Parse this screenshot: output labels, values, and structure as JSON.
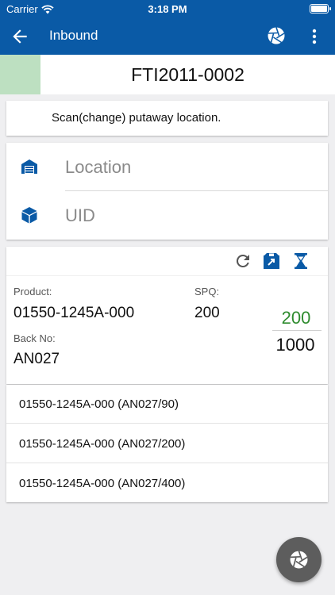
{
  "status_bar": {
    "carrier": "Carrier",
    "time": "3:18 PM"
  },
  "nav": {
    "title": "Inbound",
    "icons": {
      "back": "arrow-left-icon",
      "camera": "aperture-icon",
      "more": "more-vertical-icon"
    }
  },
  "document": {
    "number": "FTI2011-0002",
    "status_color": "#bde0c1"
  },
  "instruction": {
    "text": "Scan(change) putaway location."
  },
  "scan": {
    "location_placeholder": "Location",
    "uid_placeholder": "UID",
    "icons": {
      "location": "warehouse-icon",
      "uid": "box-icon"
    }
  },
  "product": {
    "toolbar_icons": [
      "refresh-icon",
      "box-arrow-icon",
      "hourglass-icon"
    ],
    "product_label": "Product:",
    "product_value": "01550-1245A-000",
    "spq_label": "SPQ:",
    "spq_value": "200",
    "back_no_label": "Back No:",
    "back_no_value": "AN027",
    "qty_scanned": "200",
    "qty_total": "1000"
  },
  "list": {
    "items": [
      {
        "text": "01550-1245A-000 (AN027/90)"
      },
      {
        "text": "01550-1245A-000 (AN027/200)"
      },
      {
        "text": "01550-1245A-000 (AN027/400)"
      }
    ]
  },
  "colors": {
    "primary": "#0a5aa6",
    "scanned_qty": "#2e8b2e",
    "fab": "#5d5d5d"
  }
}
